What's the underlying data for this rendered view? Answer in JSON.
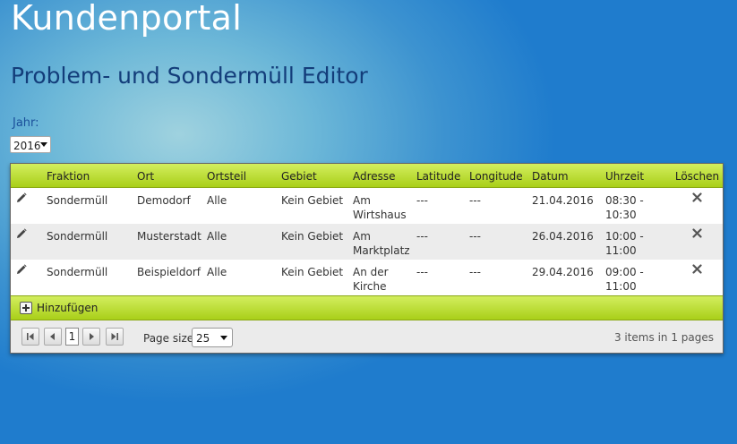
{
  "header": {
    "title": "Kundenportal",
    "subtitle": "Problem- und Sondermüll Editor"
  },
  "filter": {
    "year_label": "Jahr:",
    "year_value": "2016"
  },
  "grid": {
    "columns": {
      "fraktion": "Fraktion",
      "ort": "Ort",
      "ortsteil": "Ortsteil",
      "gebiet": "Gebiet",
      "adresse": "Adresse",
      "latitude": "Latitude",
      "longitude": "Longitude",
      "datum": "Datum",
      "uhrzeit": "Uhrzeit",
      "loeschen": "Löschen"
    },
    "rows": [
      {
        "fraktion": "Sondermüll",
        "ort": "Demodorf",
        "ortsteil": "Alle",
        "gebiet": "Kein Gebiet",
        "adresse_1": "Am",
        "adresse_2": "Wirtshaus",
        "latitude": "---",
        "longitude": "---",
        "datum": "21.04.2016",
        "uhrzeit_1": "08:30 -",
        "uhrzeit_2": "10:30"
      },
      {
        "fraktion": "Sondermüll",
        "ort": "Musterstadt",
        "ortsteil": "Alle",
        "gebiet": "Kein Gebiet",
        "adresse_1": "Am",
        "adresse_2": "Marktplatz",
        "latitude": "---",
        "longitude": "---",
        "datum": "26.04.2016",
        "uhrzeit_1": "10:00 -",
        "uhrzeit_2": "11:00"
      },
      {
        "fraktion": "Sondermüll",
        "ort": "Beispieldorf",
        "ortsteil": "Alle",
        "gebiet": "Kein Gebiet",
        "adresse_1": "An der",
        "adresse_2": "Kirche",
        "latitude": "---",
        "longitude": "---",
        "datum": "29.04.2016",
        "uhrzeit_1": "09:00 -",
        "uhrzeit_2": "11:00"
      }
    ],
    "add_label": "Hinzufügen"
  },
  "pager": {
    "current_page": "1",
    "page_size_label": "Page size:",
    "page_size_value": "25",
    "items_info": "3 items in 1 pages"
  },
  "icons": {
    "edit": "pencil-icon",
    "delete": "close-icon",
    "add": "plus-icon",
    "first": "first-page-icon",
    "prev": "prev-page-icon",
    "next": "next-page-icon",
    "last": "last-page-icon"
  },
  "colors": {
    "accent_green": "#b5d827",
    "title_blue": "#133d7a",
    "label_blue": "#1a4f9a"
  }
}
